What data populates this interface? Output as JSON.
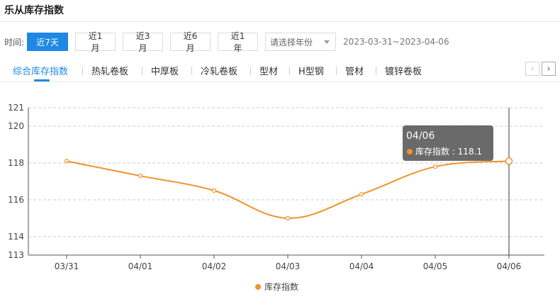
{
  "page": {
    "title": "乐从库存指数"
  },
  "filters": {
    "label": "时间:",
    "ranges": [
      "近7天",
      "近1月",
      "近3月",
      "近6月",
      "近1年"
    ],
    "active_index": 0,
    "year_placeholder": "请选择年份",
    "date_range": "2023-03-31~2023-04-06"
  },
  "tabs": {
    "items": [
      "综合库存指数",
      "热轧卷板",
      "中厚板",
      "冷轧卷板",
      "型材",
      "H型钢",
      "管材",
      "镀锌卷板"
    ],
    "active_index": 0,
    "prev_symbol": "‹",
    "next_symbol": "›"
  },
  "chart_data": {
    "type": "line",
    "x": [
      "03/31",
      "04/01",
      "04/02",
      "04/03",
      "04/04",
      "04/05",
      "04/06"
    ],
    "series": [
      {
        "name": "库存指数",
        "values": [
          118.1,
          117.3,
          116.5,
          115.0,
          116.3,
          117.8,
          118.1
        ],
        "color": "#f0932b"
      }
    ],
    "yticks": [
      113,
      114,
      116,
      118,
      120,
      121
    ],
    "ylim": [
      113,
      121
    ],
    "grid": "horizontal-dashed",
    "legend_position": "bottom-center",
    "tooltip": {
      "title": "04/06",
      "label": "库存指数 : 118.1",
      "highlight_index": 6
    }
  },
  "icons": {
    "dropdown": "caret-down-icon",
    "prev": "chevron-left-icon",
    "next": "chevron-right-icon"
  }
}
